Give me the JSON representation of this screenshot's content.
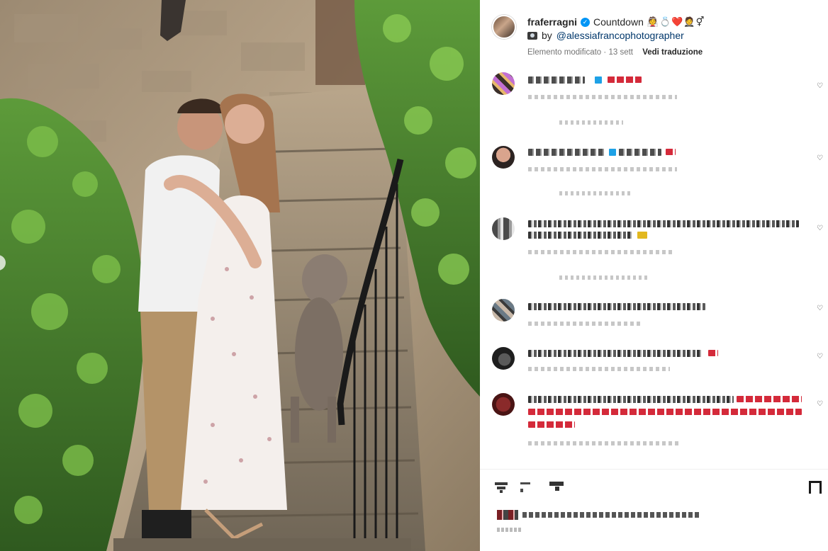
{
  "post": {
    "username": "fraferragni",
    "caption": "Countdown",
    "caption_emojis": [
      "👰",
      "💍",
      "❤️",
      "🤵",
      "⚥"
    ],
    "credit_prefix": "by",
    "credit_mention": "@alessiafrancophotographer",
    "edited_label": "Elemento modificato",
    "separator": "·",
    "time": "13 sett",
    "translate_label": "Vedi traduzione"
  },
  "icons": {
    "verified": "verified-badge-icon",
    "camera": "camera-icon",
    "like": "heart-icon",
    "comment": "comment-icon",
    "share": "share-icon",
    "save": "bookmark-icon"
  },
  "colors": {
    "link": "#00376b",
    "verified": "#0095f6",
    "meta": "#737373",
    "heart": "#d42a3a"
  }
}
